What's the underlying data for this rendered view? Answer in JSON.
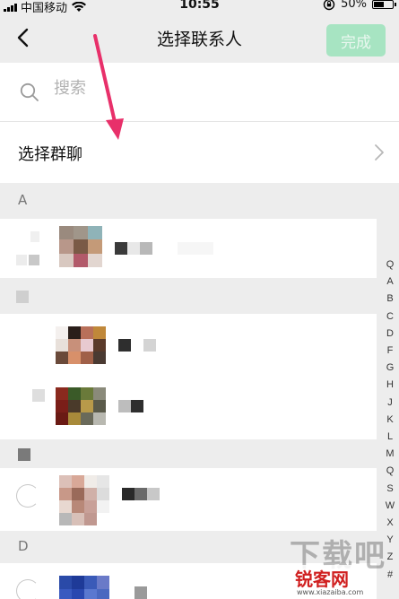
{
  "status_bar": {
    "carrier": "中国移动",
    "time": "10:55",
    "battery_percent": "50%",
    "icons": [
      "signal-icon",
      "wifi-icon",
      "rotation-lock-icon",
      "battery-icon"
    ]
  },
  "nav": {
    "title": "选择联系人",
    "done_label": "完成",
    "back_icon": "chevron-left-icon"
  },
  "search": {
    "placeholder": "搜索",
    "icon": "search-icon"
  },
  "group_chat": {
    "label": "选择群聊",
    "icon": "chevron-right-icon"
  },
  "sections": [
    {
      "letter": "A"
    },
    {
      "letter": "B"
    },
    {
      "letter": "C"
    },
    {
      "letter": "D"
    }
  ],
  "index_bar": [
    "Q",
    "A",
    "B",
    "C",
    "D",
    "F",
    "G",
    "H",
    "J",
    "K",
    "L",
    "M",
    "Q",
    "S",
    "W",
    "X",
    "Y",
    "Z",
    "#"
  ],
  "watermark": {
    "cn_text": "锐客网",
    "url_text": "www.xiazaiba.com",
    "big_text": "下载吧"
  },
  "colors": {
    "accent_done": "#a7e4c2",
    "arrow": "#e8306a",
    "background": "#ededed"
  }
}
